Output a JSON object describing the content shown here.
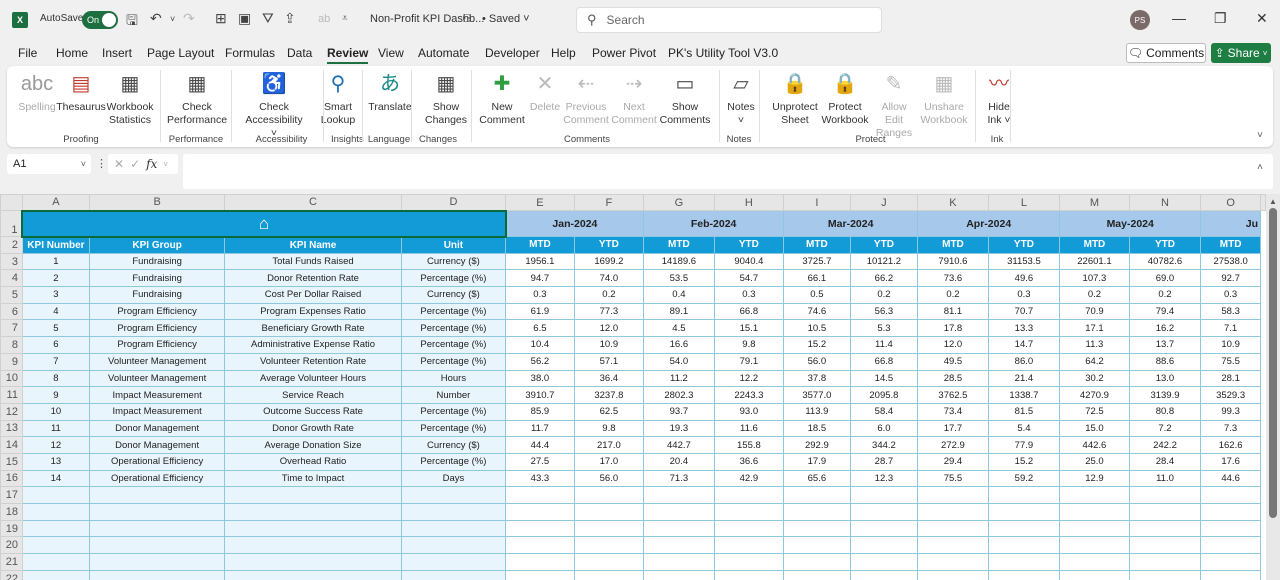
{
  "titlebar": {
    "app_icon": "excel-icon",
    "autosave_label": "AutoSave",
    "autosave_state": "On",
    "doc_title": "Non-Profit KPI Dashb...",
    "saved_label": "• Saved",
    "search_placeholder": "Search",
    "avatar_initials": "PS",
    "minimize": "—",
    "restore": "❐",
    "close": "✕"
  },
  "menu": {
    "items": [
      "File",
      "Home",
      "Insert",
      "Page Layout",
      "Formulas",
      "Data",
      "Review",
      "View",
      "Automate",
      "Developer",
      "Help",
      "Power Pivot",
      "PK's Utility Tool V3.0"
    ],
    "active": "Review",
    "comments_btn": "Comments",
    "share_btn": "Share"
  },
  "ribbon": {
    "buttons": [
      {
        "l1": "Spelling",
        "l2": "",
        "disabled": true,
        "icon": "abc"
      },
      {
        "l1": "Thesaurus",
        "l2": "",
        "disabled": false,
        "icon": "▤"
      },
      {
        "l1": "Workbook",
        "l2": "Statistics",
        "disabled": false,
        "icon": "▦"
      },
      {
        "l1": "Check",
        "l2": "Performance",
        "disabled": false,
        "icon": "▦"
      },
      {
        "l1": "Check",
        "l2": "Accessibility ˅",
        "disabled": false,
        "icon": "♿"
      },
      {
        "l1": "Smart",
        "l2": "Lookup",
        "disabled": false,
        "icon": "⚲"
      },
      {
        "l1": "Translate",
        "l2": "",
        "disabled": false,
        "icon": "あ"
      },
      {
        "l1": "Show",
        "l2": "Changes",
        "disabled": false,
        "icon": "▦"
      },
      {
        "l1": "New",
        "l2": "Comment",
        "disabled": false,
        "icon": "✚"
      },
      {
        "l1": "Delete",
        "l2": "",
        "disabled": true,
        "icon": "✕"
      },
      {
        "l1": "Previous",
        "l2": "Comment",
        "disabled": true,
        "icon": "⇠"
      },
      {
        "l1": "Next",
        "l2": "Comment",
        "disabled": true,
        "icon": "⇢"
      },
      {
        "l1": "Show",
        "l2": "Comments",
        "disabled": false,
        "icon": "▭"
      },
      {
        "l1": "Notes",
        "l2": "˅",
        "disabled": false,
        "icon": "▱"
      },
      {
        "l1": "Unprotect",
        "l2": "Sheet",
        "disabled": false,
        "icon": "🔒"
      },
      {
        "l1": "Protect",
        "l2": "Workbook",
        "disabled": false,
        "icon": "🔒"
      },
      {
        "l1": "Allow Edit",
        "l2": "Ranges",
        "disabled": true,
        "icon": "✎"
      },
      {
        "l1": "Unshare",
        "l2": "Workbook",
        "disabled": true,
        "icon": "▦"
      },
      {
        "l1": "Hide",
        "l2": "Ink ˅",
        "disabled": false,
        "icon": "〰"
      }
    ],
    "groups": [
      "Proofing",
      "Performance",
      "Accessibility",
      "Insights",
      "Language",
      "Changes",
      "Comments",
      "Notes",
      "Protect",
      "Ink"
    ]
  },
  "formula_bar": {
    "name_box": "A1",
    "cancel": "✕",
    "enter": "✓",
    "fx": "fx",
    "value": ""
  },
  "sheet": {
    "columns": [
      "A",
      "B",
      "C",
      "D",
      "E",
      "F",
      "G",
      "H",
      "I",
      "J",
      "K",
      "L",
      "M",
      "N",
      "O"
    ],
    "months": [
      "Jan-2024",
      "Feb-2024",
      "Mar-2024",
      "Apr-2024",
      "May-2024",
      "Ju"
    ],
    "headers": [
      "KPI Number",
      "KPI Group",
      "KPI Name",
      "Unit"
    ],
    "sub_headers": [
      "MTD",
      "YTD",
      "MTD",
      "YTD",
      "MTD",
      "YTD",
      "MTD",
      "YTD",
      "MTD",
      "YTD",
      "MTD"
    ],
    "rows": [
      {
        "n": "1",
        "g": "Fundraising",
        "k": "Total Funds Raised",
        "u": "Currency ($)",
        "v": [
          "1956.1",
          "1699.2",
          "14189.6",
          "9040.4",
          "3725.7",
          "10121.2",
          "7910.6",
          "31153.5",
          "22601.1",
          "40782.6",
          "27538.0"
        ]
      },
      {
        "n": "2",
        "g": "Fundraising",
        "k": "Donor Retention Rate",
        "u": "Percentage (%)",
        "v": [
          "94.7",
          "74.0",
          "53.5",
          "54.7",
          "66.1",
          "66.2",
          "73.6",
          "49.6",
          "107.3",
          "69.0",
          "92.7"
        ]
      },
      {
        "n": "3",
        "g": "Fundraising",
        "k": "Cost Per Dollar Raised",
        "u": "Currency ($)",
        "v": [
          "0.3",
          "0.2",
          "0.4",
          "0.3",
          "0.5",
          "0.2",
          "0.2",
          "0.3",
          "0.2",
          "0.2",
          "0.3"
        ]
      },
      {
        "n": "4",
        "g": "Program Efficiency",
        "k": "Program Expenses Ratio",
        "u": "Percentage (%)",
        "v": [
          "61.9",
          "77.3",
          "89.1",
          "66.8",
          "74.6",
          "56.3",
          "81.1",
          "70.7",
          "70.9",
          "79.4",
          "58.3"
        ]
      },
      {
        "n": "5",
        "g": "Program Efficiency",
        "k": "Beneficiary Growth Rate",
        "u": "Percentage (%)",
        "v": [
          "6.5",
          "12.0",
          "4.5",
          "15.1",
          "10.5",
          "5.3",
          "17.8",
          "13.3",
          "17.1",
          "16.2",
          "7.1"
        ]
      },
      {
        "n": "6",
        "g": "Program Efficiency",
        "k": "Administrative Expense Ratio",
        "u": "Percentage (%)",
        "v": [
          "10.4",
          "10.9",
          "16.6",
          "9.8",
          "15.2",
          "11.4",
          "12.0",
          "14.7",
          "11.3",
          "13.7",
          "10.9"
        ]
      },
      {
        "n": "7",
        "g": "Volunteer Management",
        "k": "Volunteer Retention Rate",
        "u": "Percentage (%)",
        "v": [
          "56.2",
          "57.1",
          "54.0",
          "79.1",
          "56.0",
          "66.8",
          "49.5",
          "86.0",
          "64.2",
          "88.6",
          "75.5"
        ]
      },
      {
        "n": "8",
        "g": "Volunteer Management",
        "k": "Average Volunteer Hours",
        "u": "Hours",
        "v": [
          "38.0",
          "36.4",
          "11.2",
          "12.2",
          "37.8",
          "14.5",
          "28.5",
          "21.4",
          "30.2",
          "13.0",
          "28.1"
        ]
      },
      {
        "n": "9",
        "g": "Impact Measurement",
        "k": "Service Reach",
        "u": "Number",
        "v": [
          "3910.7",
          "3237.8",
          "2802.3",
          "2243.3",
          "3577.0",
          "2095.8",
          "3762.5",
          "1338.7",
          "4270.9",
          "3139.9",
          "3529.3"
        ]
      },
      {
        "n": "10",
        "g": "Impact Measurement",
        "k": "Outcome Success Rate",
        "u": "Percentage (%)",
        "v": [
          "85.9",
          "62.5",
          "93.7",
          "93.0",
          "113.9",
          "58.4",
          "73.4",
          "81.5",
          "72.5",
          "80.8",
          "99.3"
        ]
      },
      {
        "n": "11",
        "g": "Donor Management",
        "k": "Donor Growth Rate",
        "u": "Percentage (%)",
        "v": [
          "11.7",
          "9.8",
          "19.3",
          "11.6",
          "18.5",
          "6.0",
          "17.7",
          "5.4",
          "15.0",
          "7.2",
          "7.3"
        ]
      },
      {
        "n": "12",
        "g": "Donor Management",
        "k": "Average Donation Size",
        "u": "Currency ($)",
        "v": [
          "44.4",
          "217.0",
          "442.7",
          "155.8",
          "292.9",
          "344.2",
          "272.9",
          "77.9",
          "442.6",
          "242.2",
          "162.6"
        ]
      },
      {
        "n": "13",
        "g": "Operational Efficiency",
        "k": "Overhead Ratio",
        "u": "Percentage (%)",
        "v": [
          "27.5",
          "17.0",
          "20.4",
          "36.6",
          "17.9",
          "28.7",
          "29.4",
          "15.2",
          "25.0",
          "28.4",
          "17.6"
        ]
      },
      {
        "n": "14",
        "g": "Operational Efficiency",
        "k": "Time to Impact",
        "u": "Days",
        "v": [
          "43.3",
          "56.0",
          "71.3",
          "42.9",
          "65.6",
          "12.3",
          "75.5",
          "59.2",
          "12.9",
          "11.0",
          "44.6"
        ]
      }
    ],
    "empty_row_numbers": [
      "17",
      "18",
      "19",
      "20",
      "21",
      "22"
    ],
    "colors": {
      "header_blue": "#129bd6",
      "month_blue": "#a6c8ea",
      "label_fill": "#e9f5fc",
      "grid_line": "#8dc8e0",
      "excel_green": "#1d6f42"
    }
  }
}
